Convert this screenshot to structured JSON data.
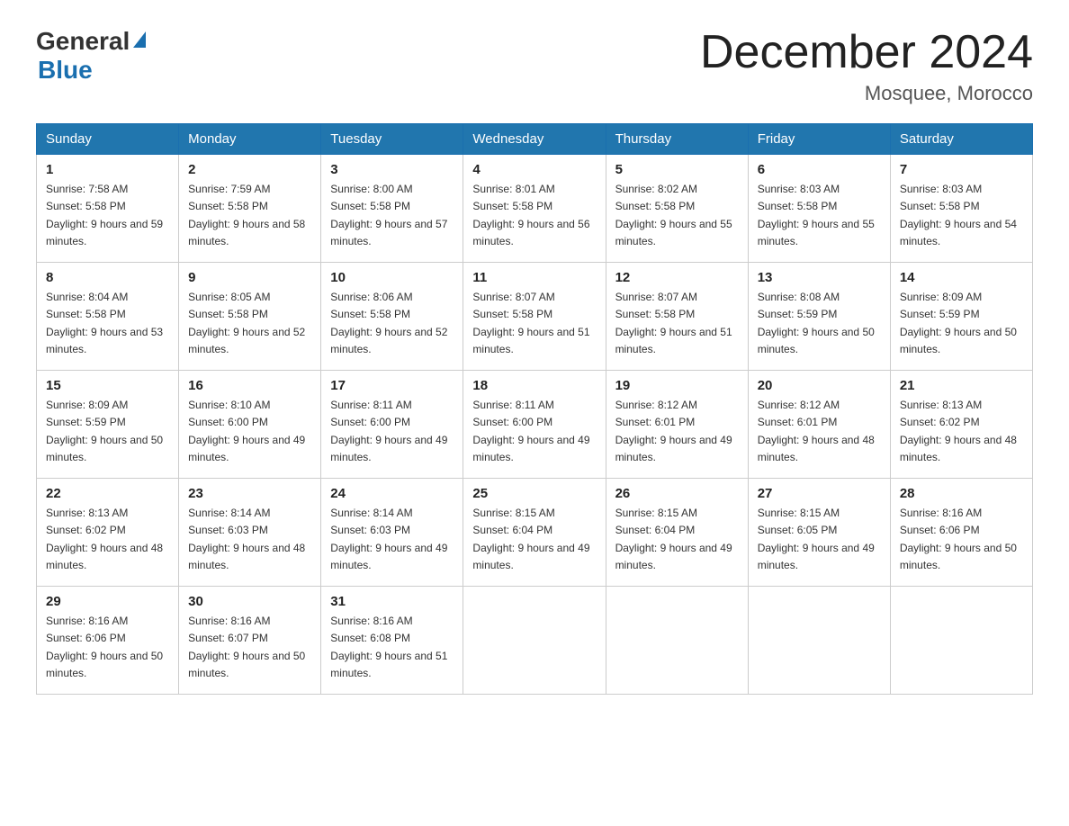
{
  "header": {
    "logo_general": "General",
    "logo_blue": "Blue",
    "month_title": "December 2024",
    "location": "Mosquee, Morocco"
  },
  "weekdays": [
    "Sunday",
    "Monday",
    "Tuesday",
    "Wednesday",
    "Thursday",
    "Friday",
    "Saturday"
  ],
  "weeks": [
    [
      {
        "day": "1",
        "sunrise": "7:58 AM",
        "sunset": "5:58 PM",
        "daylight": "9 hours and 59 minutes."
      },
      {
        "day": "2",
        "sunrise": "7:59 AM",
        "sunset": "5:58 PM",
        "daylight": "9 hours and 58 minutes."
      },
      {
        "day": "3",
        "sunrise": "8:00 AM",
        "sunset": "5:58 PM",
        "daylight": "9 hours and 57 minutes."
      },
      {
        "day": "4",
        "sunrise": "8:01 AM",
        "sunset": "5:58 PM",
        "daylight": "9 hours and 56 minutes."
      },
      {
        "day": "5",
        "sunrise": "8:02 AM",
        "sunset": "5:58 PM",
        "daylight": "9 hours and 55 minutes."
      },
      {
        "day": "6",
        "sunrise": "8:03 AM",
        "sunset": "5:58 PM",
        "daylight": "9 hours and 55 minutes."
      },
      {
        "day": "7",
        "sunrise": "8:03 AM",
        "sunset": "5:58 PM",
        "daylight": "9 hours and 54 minutes."
      }
    ],
    [
      {
        "day": "8",
        "sunrise": "8:04 AM",
        "sunset": "5:58 PM",
        "daylight": "9 hours and 53 minutes."
      },
      {
        "day": "9",
        "sunrise": "8:05 AM",
        "sunset": "5:58 PM",
        "daylight": "9 hours and 52 minutes."
      },
      {
        "day": "10",
        "sunrise": "8:06 AM",
        "sunset": "5:58 PM",
        "daylight": "9 hours and 52 minutes."
      },
      {
        "day": "11",
        "sunrise": "8:07 AM",
        "sunset": "5:58 PM",
        "daylight": "9 hours and 51 minutes."
      },
      {
        "day": "12",
        "sunrise": "8:07 AM",
        "sunset": "5:58 PM",
        "daylight": "9 hours and 51 minutes."
      },
      {
        "day": "13",
        "sunrise": "8:08 AM",
        "sunset": "5:59 PM",
        "daylight": "9 hours and 50 minutes."
      },
      {
        "day": "14",
        "sunrise": "8:09 AM",
        "sunset": "5:59 PM",
        "daylight": "9 hours and 50 minutes."
      }
    ],
    [
      {
        "day": "15",
        "sunrise": "8:09 AM",
        "sunset": "5:59 PM",
        "daylight": "9 hours and 50 minutes."
      },
      {
        "day": "16",
        "sunrise": "8:10 AM",
        "sunset": "6:00 PM",
        "daylight": "9 hours and 49 minutes."
      },
      {
        "day": "17",
        "sunrise": "8:11 AM",
        "sunset": "6:00 PM",
        "daylight": "9 hours and 49 minutes."
      },
      {
        "day": "18",
        "sunrise": "8:11 AM",
        "sunset": "6:00 PM",
        "daylight": "9 hours and 49 minutes."
      },
      {
        "day": "19",
        "sunrise": "8:12 AM",
        "sunset": "6:01 PM",
        "daylight": "9 hours and 49 minutes."
      },
      {
        "day": "20",
        "sunrise": "8:12 AM",
        "sunset": "6:01 PM",
        "daylight": "9 hours and 48 minutes."
      },
      {
        "day": "21",
        "sunrise": "8:13 AM",
        "sunset": "6:02 PM",
        "daylight": "9 hours and 48 minutes."
      }
    ],
    [
      {
        "day": "22",
        "sunrise": "8:13 AM",
        "sunset": "6:02 PM",
        "daylight": "9 hours and 48 minutes."
      },
      {
        "day": "23",
        "sunrise": "8:14 AM",
        "sunset": "6:03 PM",
        "daylight": "9 hours and 48 minutes."
      },
      {
        "day": "24",
        "sunrise": "8:14 AM",
        "sunset": "6:03 PM",
        "daylight": "9 hours and 49 minutes."
      },
      {
        "day": "25",
        "sunrise": "8:15 AM",
        "sunset": "6:04 PM",
        "daylight": "9 hours and 49 minutes."
      },
      {
        "day": "26",
        "sunrise": "8:15 AM",
        "sunset": "6:04 PM",
        "daylight": "9 hours and 49 minutes."
      },
      {
        "day": "27",
        "sunrise": "8:15 AM",
        "sunset": "6:05 PM",
        "daylight": "9 hours and 49 minutes."
      },
      {
        "day": "28",
        "sunrise": "8:16 AM",
        "sunset": "6:06 PM",
        "daylight": "9 hours and 50 minutes."
      }
    ],
    [
      {
        "day": "29",
        "sunrise": "8:16 AM",
        "sunset": "6:06 PM",
        "daylight": "9 hours and 50 minutes."
      },
      {
        "day": "30",
        "sunrise": "8:16 AM",
        "sunset": "6:07 PM",
        "daylight": "9 hours and 50 minutes."
      },
      {
        "day": "31",
        "sunrise": "8:16 AM",
        "sunset": "6:08 PM",
        "daylight": "9 hours and 51 minutes."
      },
      null,
      null,
      null,
      null
    ]
  ]
}
